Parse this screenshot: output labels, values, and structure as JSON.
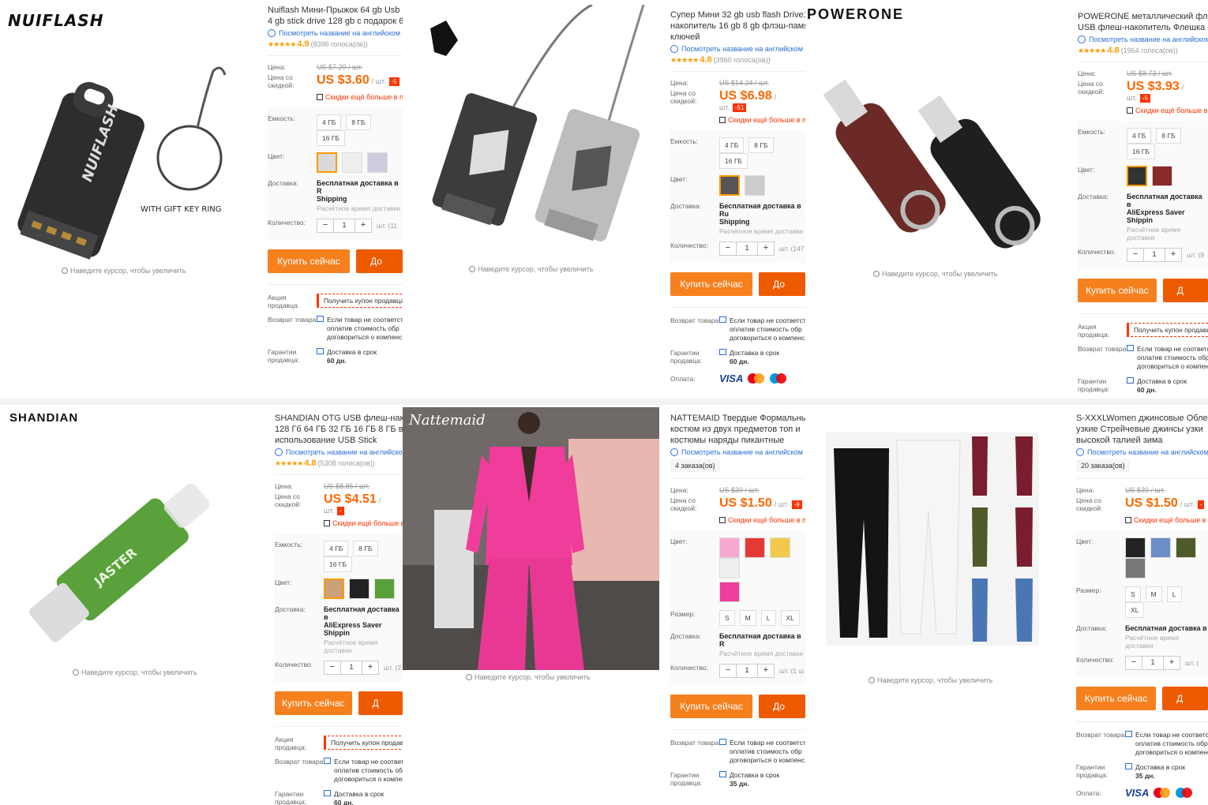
{
  "common": {
    "zoom_hint": "Наведите курсор, чтобы увеличить",
    "translate": "Посмотреть название на английском",
    "price_label": "Цена:",
    "sale_label": "Цена со скидкой:",
    "more_discount": "Скидки ещё больше в п",
    "capacity_label": "Емкость:",
    "color_label": "Цвет:",
    "size_label": "Размер:",
    "shipping_label": "Доставка:",
    "shipping_time": "Расчётное время доставки",
    "qty_label": "Количество:",
    "buy_now": "Купить сейчас",
    "promo_label": "Акция продавца:",
    "coupon": "Получить купон продавца",
    "return_label": "Возврат товара",
    "return_text": [
      "Если товар не соответствует",
      "оплатив стоимость обр",
      "договориться о компенс"
    ],
    "guarantee_label": "Гарантии продавца:",
    "on_time": "Доставка в срок",
    "pay_label": "Оплата:",
    "visa": "VISA",
    "qty_value": "1",
    "minus": "−",
    "plus": "+",
    "accent": "#f7801e",
    "price_color": "#ff6600"
  },
  "tiles": [
    {
      "brand": "NUIFLASH",
      "image_caption": "WITH GIFT KEY RING",
      "title": [
        "Nuiflash Мини-Прыжок 64 gb Usb",
        "4 gb stick drive 128 gb с подарок 6"
      ],
      "rating": "4.9",
      "votes": "(8396 голоса(ов))",
      "old_price": "US $7.20 / шт.",
      "new_price": "US $3.60",
      "unit": "/ шт.",
      "discount": "-5",
      "capacities": [
        "4 ГБ",
        "8 ГБ",
        "16 ГБ"
      ],
      "shipping": [
        "Бесплатная доставка в R",
        "Shipping"
      ],
      "qty_unit": "шт. (11",
      "cart": "До",
      "guarantee_days": "60 дн."
    },
    {
      "title": [
        "Супер Мини 32 gb usb flash Drive1",
        "накопитель 16 gb 8 gb флэш-памя",
        "ключей"
      ],
      "rating": "4.8",
      "votes": "(3960 голоса(ов))",
      "old_price": "US $14.24 / шт.",
      "new_price": "US $6.98",
      "unit": "/ шт.",
      "discount": "-51",
      "capacities": [
        "4 ГБ",
        "8 ГБ",
        "16 ГБ"
      ],
      "shipping": [
        "Бесплатная доставка в Ru",
        "Shipping"
      ],
      "qty_unit": "шт. (147",
      "cart": "До",
      "guarantee_days": "60 дн."
    },
    {
      "brand": "POWERONE",
      "title": [
        "POWERONE металлический флеш",
        "USB флеш-накопитель Флешка с"
      ],
      "rating": "4.8",
      "votes": "(1964 голоса(ов))",
      "old_price": "US $8.73 / шт.",
      "new_price": "US $3.93",
      "unit": "/ шт.",
      "discount": "-5",
      "capacities": [
        "4 ГБ",
        "8 ГБ",
        "16 ГБ"
      ],
      "shipping": [
        "Бесплатная доставка в",
        "AliExpress Saver Shippin"
      ],
      "qty_unit": "шт. (9",
      "cart": "Д",
      "guarantee_days": "60 дн."
    },
    {
      "brand": "SHANDIAN",
      "image_text": "JASTER",
      "title": [
        "SHANDIAN OTG USB флеш-накоп",
        "128 Гб 64 ГБ 32 ГБ 16 ГБ 8 ГБ вне",
        "использование USB Stick"
      ],
      "rating": "4.8",
      "votes": "(5308 голоса(ов))",
      "old_price": "US $8.85 / шт.",
      "new_price": "US $4.51",
      "unit": "/ шт.",
      "discount": "-",
      "capacities": [
        "4 ГБ",
        "8 ГБ",
        "16 ГБ"
      ],
      "shipping": [
        "Бесплатная доставка в",
        "AliExpress Saver Shippin"
      ],
      "qty_unit": "шт. (2",
      "cart": "Д",
      "guarantee_days": "60 дн."
    },
    {
      "watermark": "Nattemaid",
      "title": [
        "NATTEMAID Твердые Формальны",
        "костюм из двух предметов топ и",
        "костюмы наряды пикантные"
      ],
      "orders": "4 заказа(ов)",
      "old_price": "US $30 / шт.",
      "new_price": "US $1.50",
      "unit": "/ шт.",
      "discount": "-9",
      "sizes": [
        "S",
        "M",
        "L",
        "XL"
      ],
      "shipping": [
        "Бесплатная доставка в R"
      ],
      "qty_unit": "шт. (1 ш",
      "cart": "До",
      "guarantee_days": "35 дн."
    },
    {
      "title": [
        "S-XXXLWomen джинсовые Облег",
        "узкие Стрейчевые джинсы узки",
        "высокой талией зима"
      ],
      "orders": "20 заказа(ов)",
      "old_price": "US $30 / шт.",
      "new_price": "US $1.50",
      "unit": "/ шт.",
      "discount": "-",
      "sizes": [
        "S",
        "M",
        "L",
        "XL"
      ],
      "shipping": [
        "Бесплатная доставка в"
      ],
      "qty_unit": "шт. (",
      "cart": "Д",
      "guarantee_days": "35 дн."
    }
  ]
}
